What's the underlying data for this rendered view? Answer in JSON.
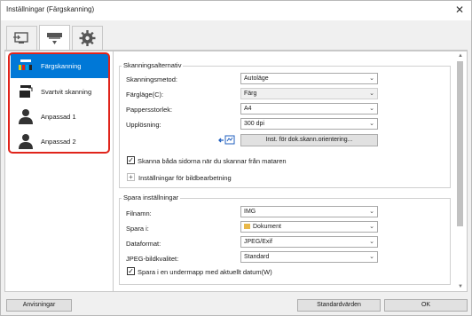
{
  "window": {
    "title": "Inställningar (Färgskanning)"
  },
  "tabs": [
    {
      "icon": "scan-to-computer-icon"
    },
    {
      "icon": "scanner-icon"
    },
    {
      "icon": "gear-icon"
    }
  ],
  "sidebar": {
    "items": [
      {
        "label": "Färgskanning",
        "icon": "color-scan-icon",
        "selected": true
      },
      {
        "label": "Svartvit skanning",
        "icon": "bw-scan-icon",
        "selected": false
      },
      {
        "label": "Anpassad 1",
        "icon": "person-icon",
        "selected": false
      },
      {
        "label": "Anpassad 2",
        "icon": "person-icon",
        "selected": false
      }
    ]
  },
  "scan_options": {
    "title": "Skanningsalternativ",
    "method_label": "Skanningsmetod:",
    "method_value": "Autoläge",
    "color_label": "Färgläge(C):",
    "color_value": "Färg",
    "paper_label": "Pappersstorlek:",
    "paper_value": "A4",
    "resolution_label": "Upplösning:",
    "resolution_value": "300 dpi",
    "orientation_button": "Inst. för dok.skann.orientering...",
    "duplex_checkbox": "Skanna båda sidorna när du skannar från mataren",
    "image_settings_label": "Inställningar för bildbearbetning"
  },
  "save_settings": {
    "title": "Spara inställningar",
    "filename_label": "Filnamn:",
    "filename_value": "IMG",
    "save_in_label": "Spara i:",
    "save_in_value": "Dokument",
    "format_label": "Dataformat:",
    "format_value": "JPEG/Exif",
    "quality_label": "JPEG-bildkvalitet:",
    "quality_value": "Standard",
    "subfolder_checkbox": "Spara i en undermapp med aktuellt datum(W)"
  },
  "footer": {
    "instructions_button": "Anvisningar",
    "defaults_button": "Standardvärden",
    "ok_button": "OK"
  }
}
